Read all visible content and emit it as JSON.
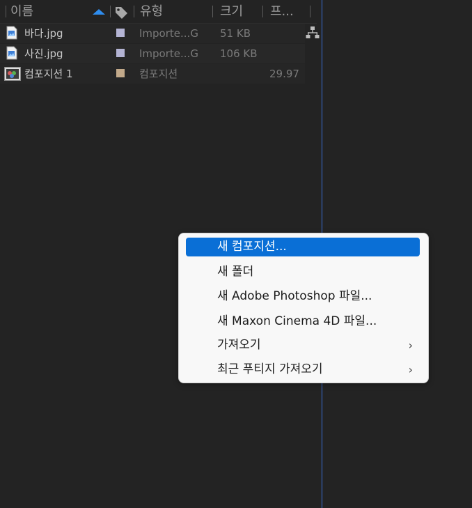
{
  "project_panel": {
    "columns": {
      "name": "이름",
      "type": "유형",
      "size": "크기",
      "frame": "프..."
    },
    "rows": [
      {
        "name": "바다.jpg",
        "label_color": "#b4b4d4",
        "type": "Importe...G",
        "size": "51 KB",
        "frame": "",
        "icon": "image-file-icon"
      },
      {
        "name": "사진.jpg",
        "label_color": "#b4b4d4",
        "type": "Importe...G",
        "size": "106 KB",
        "frame": "",
        "icon": "image-file-icon"
      },
      {
        "name": "컴포지션 1",
        "label_color": "#c2a98a",
        "type": "컴포지션",
        "size": "",
        "frame": "29.97",
        "icon": "composition-icon"
      }
    ],
    "accent_color": "#2f8dee"
  },
  "context_menu": {
    "items": [
      {
        "label": "새 컴포지션...",
        "highlighted": true,
        "submenu": false
      },
      {
        "label": "새 폴더",
        "highlighted": false,
        "submenu": false
      },
      {
        "label": "새 Adobe Photoshop 파일...",
        "highlighted": false,
        "submenu": false
      },
      {
        "label": "새 Maxon Cinema 4D 파일...",
        "highlighted": false,
        "submenu": false
      },
      {
        "label": "가져오기",
        "highlighted": false,
        "submenu": true
      },
      {
        "label": "최근 푸티지 가져오기",
        "highlighted": false,
        "submenu": true
      }
    ],
    "chevron": "›",
    "highlight_color": "#0a6fd6"
  }
}
